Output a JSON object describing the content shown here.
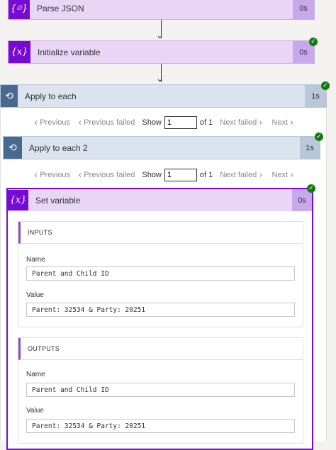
{
  "colors": {
    "variable_light": "#e9d6f7",
    "variable_dark": "#770bd6",
    "loop_light": "#dbe3ee",
    "loop_dark": "#486991",
    "success": "#107c10"
  },
  "steps": {
    "parse_json": {
      "label": "Parse JSON",
      "duration": "0s",
      "icon": "braces-icon"
    },
    "init_variable": {
      "label": "Initialize variable",
      "duration": "0s",
      "icon": "variable-icon",
      "status": "succeeded"
    },
    "apply_each": {
      "label": "Apply to each",
      "duration": "1s",
      "icon": "loop-icon",
      "status": "succeeded"
    },
    "apply_each_2": {
      "label": "Apply to each 2",
      "duration": "1s",
      "icon": "loop-icon",
      "status": "succeeded"
    },
    "set_variable": {
      "label": "Set variable",
      "duration": "0s",
      "icon": "variable-icon",
      "status": "succeeded"
    }
  },
  "pager1": {
    "previous": "Previous",
    "previous_failed": "Previous failed",
    "show": "Show",
    "value": "1",
    "of": "of 1",
    "next_failed": "Next failed",
    "next": "Next"
  },
  "pager2": {
    "previous": "Previous",
    "previous_failed": "Previous failed",
    "show": "Show",
    "value": "1",
    "of": "of 1",
    "next_failed": "Next failed",
    "next": "Next"
  },
  "inputs": {
    "title": "INPUTS",
    "name_label": "Name",
    "name_value": "Parent and Child ID",
    "value_label": "Value",
    "value_value": "Parent: 32534 & Party: 20251"
  },
  "outputs": {
    "title": "OUTPUTS",
    "name_label": "Name",
    "name_value": "Parent and Child ID",
    "value_label": "Value",
    "value_value": "Parent: 32534 & Party: 20251"
  }
}
